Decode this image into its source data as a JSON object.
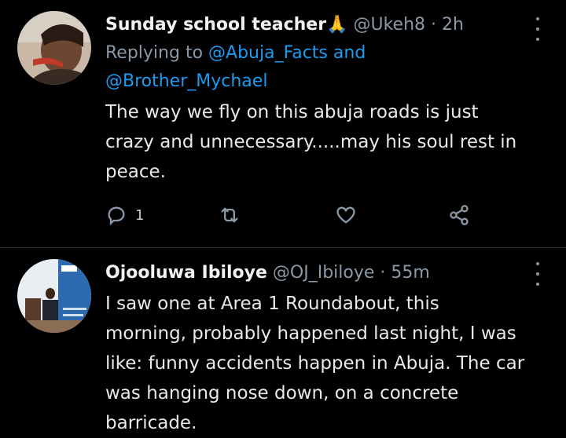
{
  "tweets": [
    {
      "name": "Sunday school teacher",
      "emoji": "🙏",
      "handle": "@Ukeh8",
      "dot": "·",
      "time": "2h",
      "replying_prefix": "Replying to",
      "replying_to_1": "@Abuja_Facts",
      "replying_and": "and",
      "replying_to_2": "@Brother_Mychael",
      "text": "The way we fly on this abuja roads is just crazy and unnecessary.....may his soul rest in peace.",
      "reply_count": "1",
      "icons": [
        "reply-icon",
        "retweet-icon",
        "like-icon",
        "share-icon"
      ]
    },
    {
      "name": "Ojooluwa Ibiloye",
      "handle": "@OJ_Ibiloye",
      "dot": "·",
      "time": "55m",
      "text": "I saw one at Area 1 Roundabout, this morning, probably happened last night, I was like: funny accidents happen in Abuja. The car was hanging nose down, on a concrete barricade."
    }
  ],
  "colors": {
    "background": "#000000",
    "link": "#1d9bf0",
    "muted": "#8b98a5",
    "text": "#e7e9ea"
  }
}
